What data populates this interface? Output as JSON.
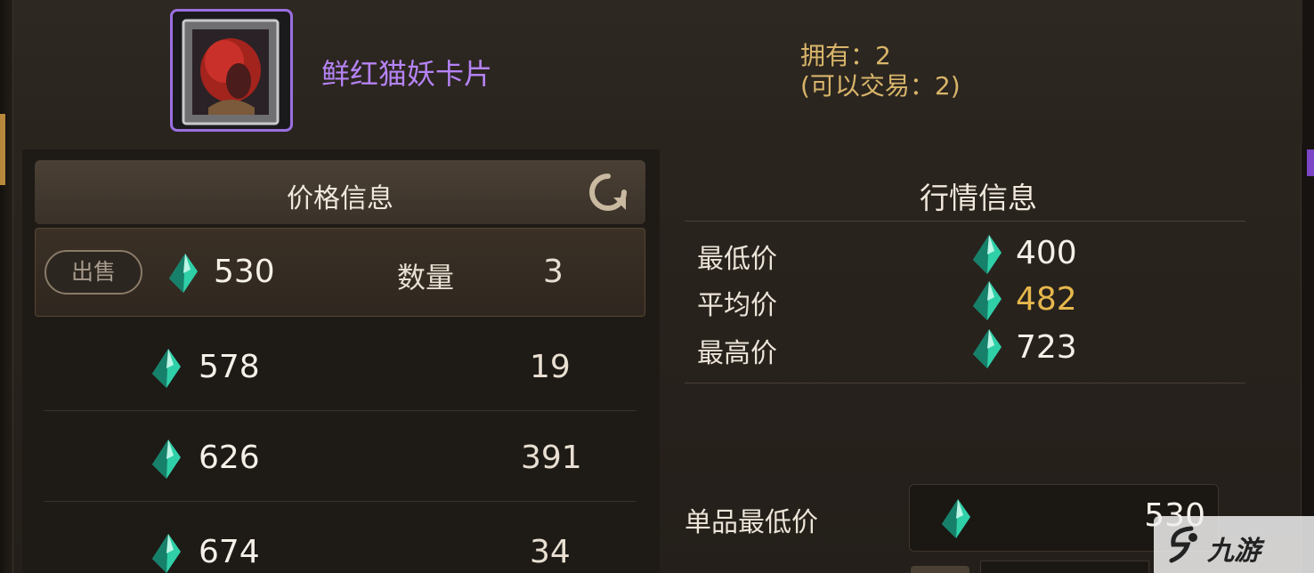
{
  "item": {
    "name": "鲜红猫妖卡片",
    "owned": "拥有：2",
    "tradable": "(可以交易：2)"
  },
  "price_panel": {
    "title": "价格信息",
    "sell_label": "出售",
    "qty_label": "数量",
    "listings": [
      {
        "price": "530",
        "qty": "3"
      },
      {
        "price": "578",
        "qty": "19"
      },
      {
        "price": "626",
        "qty": "391"
      },
      {
        "price": "674",
        "qty": "34"
      }
    ]
  },
  "market_panel": {
    "title": "行情信息",
    "lowest_label": "最低价",
    "lowest_value": "400",
    "average_label": "平均价",
    "average_value": "482",
    "highest_label": "最高价",
    "highest_value": "723",
    "unit_min_label": "单品最低价",
    "unit_min_value": "530"
  },
  "watermark": {
    "text": "九游"
  },
  "colors": {
    "item_name": "#b583f5",
    "owned_text": "#d8b56a",
    "average_value": "#e6b84c",
    "gem": "#2fd0a8"
  },
  "icons": {
    "gem": "gem-icon",
    "refresh": "refresh-icon"
  }
}
